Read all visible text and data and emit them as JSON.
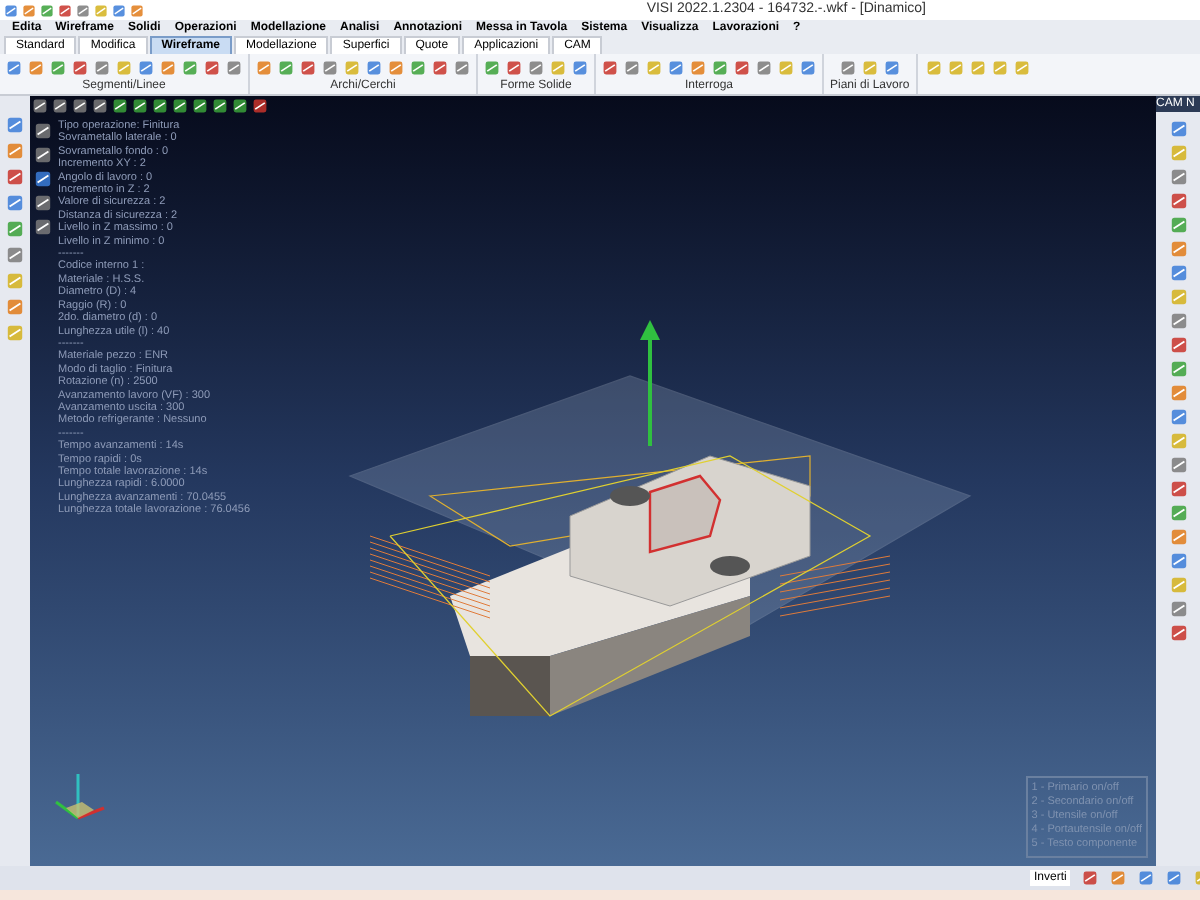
{
  "window": {
    "title": "VISI 2022.1.2304 - 164732.-.wkf - [Dinamico]"
  },
  "menu": [
    "Edita",
    "Wireframe",
    "Solidi",
    "Operazioni",
    "Modellazione",
    "Analisi",
    "Annotazioni",
    "Messa in Tavola",
    "Sistema",
    "Visualizza",
    "Lavorazioni",
    "?"
  ],
  "tabs": [
    {
      "label": "Standard",
      "selected": false
    },
    {
      "label": "Modifica",
      "selected": false
    },
    {
      "label": "Wireframe",
      "selected": true
    },
    {
      "label": "Modellazione",
      "selected": false
    },
    {
      "label": "Superfici",
      "selected": false
    },
    {
      "label": "Quote",
      "selected": false
    },
    {
      "label": "Applicazioni",
      "selected": false
    },
    {
      "label": "CAM",
      "selected": false
    }
  ],
  "ribbon_groups": [
    {
      "label": "Segmenti/Linee"
    },
    {
      "label": "Archi/Cerchi"
    },
    {
      "label": "Forme Solide"
    },
    {
      "label": "Interroga"
    },
    {
      "label": "Piani di Lavoro"
    }
  ],
  "info_lines": [
    "Tipo operazione: Finitura",
    "Sovrametallo laterale : 0",
    "Sovrametallo fondo : 0",
    "Incremento XY : 2",
    "Angolo di lavoro : 0",
    "Incremento in Z : 2",
    "Valore di sicurezza : 2",
    "Distanza di sicurezza : 2",
    "Livello in Z massimo : 0",
    "Livello in Z minimo : 0",
    "-------",
    "Codice interno 1 :",
    "Materiale : H.S.S.",
    "Diametro (D) : 4",
    "Raggio (R) : 0",
    "2do. diametro (d) : 0",
    "Lunghezza utile (l) : 40",
    "-------",
    "Materiale pezzo : ENR",
    "Modo di taglio : Finitura",
    "Rotazione (n) : 2500",
    "Avanzamento lavoro (VF) : 300",
    "Avanzamento uscita : 300",
    "Metodo refrigerante : Nessuno",
    "-------",
    "Tempo avanzamenti : 14s",
    "Tempo rapidi : 0s",
    "Tempo totale lavorazione : 14s",
    "Lunghezza rapidi : 6.0000",
    "Lunghezza avanzamenti : 70.0455",
    "Lunghezza totale lavorazione : 76.0456"
  ],
  "legend": [
    "1 - Primario on/off",
    "2 - Secondario on/off",
    "3 - Utensile on/off",
    "4 - Portautensile on/off",
    "5 - Testo componente"
  ],
  "side_panel": {
    "title": "CAM N"
  },
  "status_bar": {
    "button": "Inverti"
  }
}
